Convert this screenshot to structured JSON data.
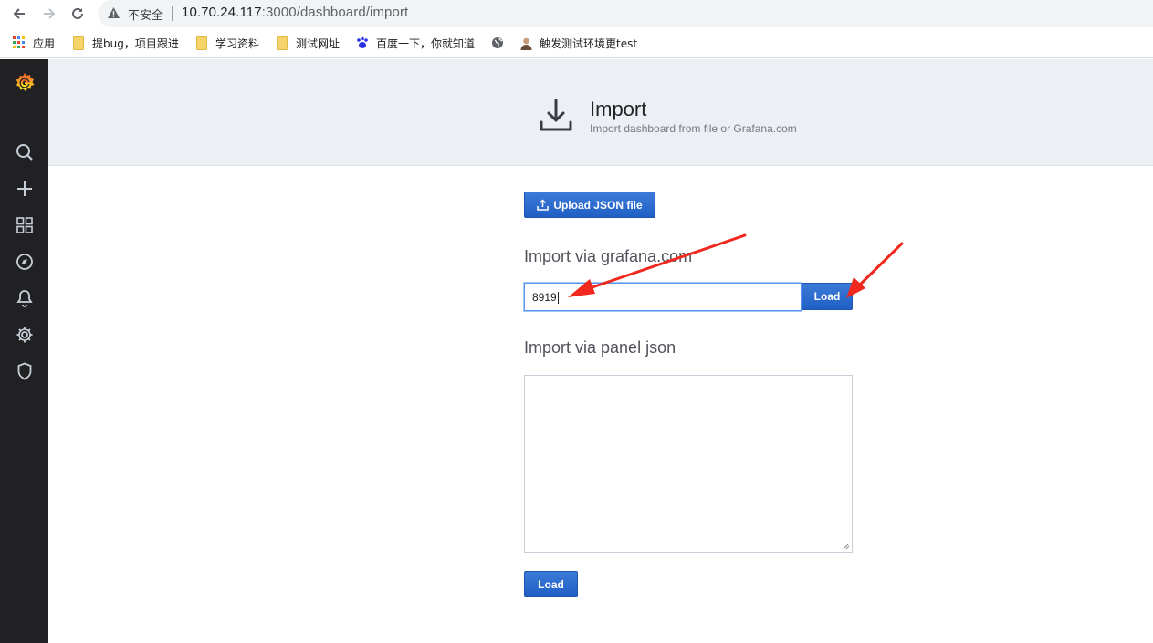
{
  "browser": {
    "security_label": "不安全",
    "url_host": "10.70.24.117",
    "url_path": ":3000/dashboard/import"
  },
  "bookmarks": [
    {
      "label": "应用",
      "icon": "apps-grid-icon"
    },
    {
      "label": "提bug，项目跟进",
      "icon": "folder-icon"
    },
    {
      "label": "学习资料",
      "icon": "folder-icon"
    },
    {
      "label": "测试网址",
      "icon": "folder-icon"
    },
    {
      "label": "百度一下，你就知道",
      "icon": "baidu-paw-icon"
    },
    {
      "label": "",
      "icon": "globe-icon"
    },
    {
      "label": "触发测试环境更test",
      "icon": "avatar-icon"
    }
  ],
  "sidebar": {
    "items": [
      "grafana-logo",
      "search-icon",
      "plus-icon",
      "dashboards-icon",
      "explore-compass-icon",
      "alerting-bell-icon",
      "configuration-gear-icon",
      "server-admin-shield-icon"
    ]
  },
  "header": {
    "title": "Import",
    "subtitle": "Import dashboard from file or Grafana.com"
  },
  "main": {
    "upload_label": "Upload JSON file",
    "grafana_section_title": "Import via grafana.com",
    "grafana_input_value": "8919",
    "grafana_load_label": "Load",
    "panel_json_title": "Import via panel json",
    "panel_json_value": "",
    "panel_load_label": "Load"
  },
  "colors": {
    "accent": "#1f60c4",
    "sidebar": "#212124",
    "annotation_arrow": "#f0281e"
  }
}
